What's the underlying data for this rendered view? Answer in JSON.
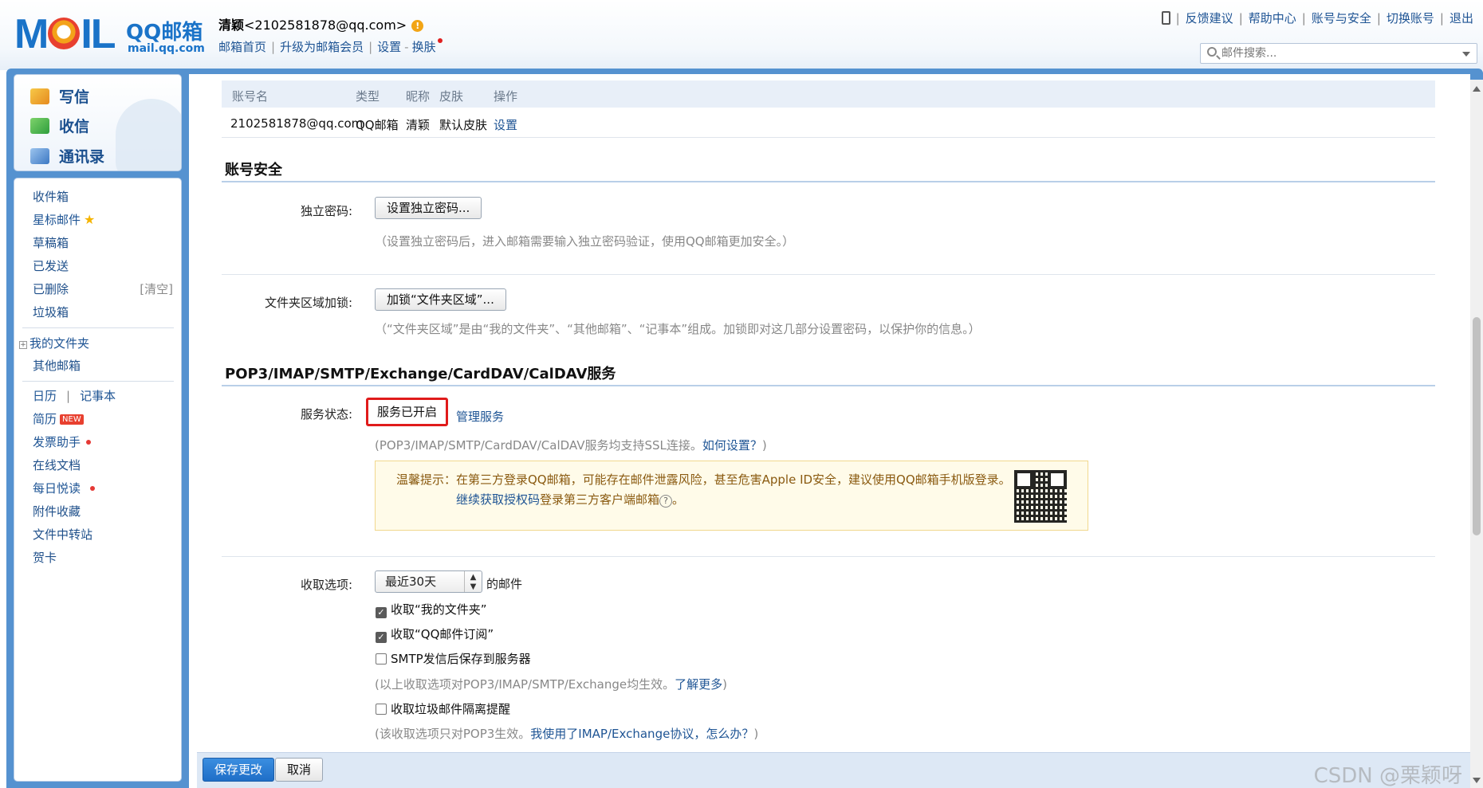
{
  "header": {
    "logo_mail": "MAIL",
    "logo_brand": "QQ邮箱",
    "logo_domain": "mail.qq.com",
    "user_nick": "清颖",
    "user_email": "<2102581878@qq.com>",
    "links": [
      "邮箱首页",
      "升级为邮箱会员",
      "设置",
      "换肤"
    ],
    "top_links": [
      "反馈建议",
      "帮助中心",
      "账号与安全",
      "切换账号",
      "退出"
    ],
    "search_placeholder": "邮件搜索..."
  },
  "quick_actions": [
    "写信",
    "收信",
    "通讯录"
  ],
  "folders": {
    "system": [
      "收件箱",
      "星标邮件",
      "草稿箱",
      "已发送",
      "已删除",
      "垃圾箱"
    ],
    "clear_label": "[清空]",
    "mine": [
      "我的文件夹",
      "其他邮箱"
    ],
    "calendar": "日历",
    "notebook": "记事本",
    "apps": [
      "简历",
      "发票助手",
      "在线文档",
      "每日悦读",
      "附件收藏",
      "文件中转站",
      "贺卡"
    ],
    "new_badge": "NEW"
  },
  "account_table": {
    "headers": [
      "账号名",
      "类型",
      "昵称",
      "皮肤",
      "操作"
    ],
    "row": [
      "2102581878@qq.com",
      "QQ邮箱",
      "清颖",
      "默认皮肤",
      "设置"
    ]
  },
  "security": {
    "title": "账号安全",
    "password_label": "独立密码:",
    "password_button": "设置独立密码...",
    "password_hint": "（设置独立密码后，进入邮箱需要输入独立密码验证，使用QQ邮箱更加安全。）",
    "folder_lock_label": "文件夹区域加锁:",
    "folder_lock_button": "加锁“文件夹区域”...",
    "folder_lock_hint": "（“文件夹区域”是由“我的文件夹”、“其他邮箱”、“记事本”组成。加锁即对这几部分设置密码，以保护你的信息。）"
  },
  "services": {
    "title": "POP3/IMAP/SMTP/Exchange/CardDAV/CalDAV服务",
    "status_label": "服务状态:",
    "status_value": "服务已开启",
    "manage_link": "管理服务",
    "ssl_hint": "(POP3/IMAP/SMTP/CardDAV/CalDAV服务均支持SSL连接。",
    "ssl_link": "如何设置？",
    "ssl_close": ")",
    "tip_line1": "温馨提示：在第三方登录QQ邮箱，可能存在邮件泄露风险，甚至危害Apple ID安全，建议使用QQ邮箱手机版登录。",
    "tip_link": "继续获取授权码",
    "tip_line2_rest": "登录第三方客户端邮箱",
    "tip_line2_end": "。"
  },
  "receive": {
    "label": "收取选项:",
    "select_value": "最近30天",
    "select_suffix": "的邮件",
    "options": [
      {
        "label": "收取“我的文件夹”",
        "checked": true
      },
      {
        "label": "收取“QQ邮件订阅”",
        "checked": true
      },
      {
        "label": "SMTP发信后保存到服务器",
        "checked": false
      }
    ],
    "hint1": "(以上收取选项对POP3/IMAP/SMTP/Exchange均生效。",
    "hint1_link": "了解更多",
    "hint1_close": ")",
    "spam_option": {
      "label": "收取垃圾邮件隔离提醒",
      "checked": false
    },
    "hint2": "(该收取选项只对POP3生效。",
    "hint2_link": "我使用了IMAP/Exchange协议，怎么办？",
    "hint2_close": ")"
  },
  "bottom": {
    "save": "保存更改",
    "cancel": "取消",
    "watermark": "CSDN @栗颖呀"
  }
}
